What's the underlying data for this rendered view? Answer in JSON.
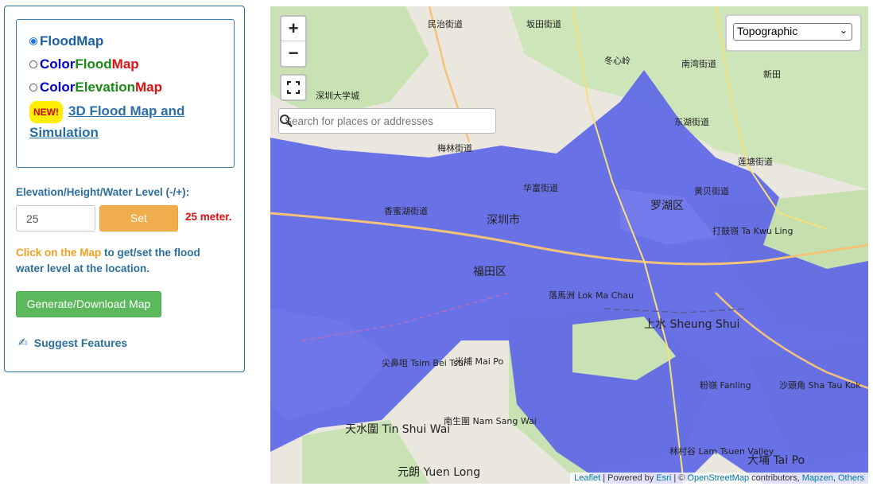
{
  "modes": {
    "floodmap": "FloodMap",
    "color_floodmap": {
      "prefix": "Color ",
      "flood": "Flood",
      "map": "Map"
    },
    "color_elevationmap": {
      "prefix": "Color ",
      "elevation": "Elevation",
      "map": "Map"
    },
    "new_badge": "NEW!",
    "flood_3d_link": "3D Flood Map and Simulation"
  },
  "level": {
    "label": "Elevation/Height/Water Level (-/+):",
    "value": "25",
    "set_button": "Set",
    "unit_display": "25 meter."
  },
  "hint": {
    "highlight": "Click on the Map",
    "rest": " to get/set the flood water level at the location."
  },
  "generate_button": "Generate/Download Map",
  "suggest_features": "Suggest Features",
  "map": {
    "zoom_in": "+",
    "zoom_out": "−",
    "search_placeholder": "Search for places or addresses",
    "layer_selected": "Topographic",
    "attribution": {
      "leaflet": "Leaflet",
      "powered": " | Powered by ",
      "esri": "Esri",
      "sep": " | © ",
      "osm": "OpenStreetMap",
      "contrib": " contributors, ",
      "mapzen": "Mapzen",
      "comma": ", ",
      "others": "Others"
    },
    "labels": [
      {
        "text": "民治街道"
      },
      {
        "text": "坂田街道"
      },
      {
        "text": "冬心岭"
      },
      {
        "text": "南湾街道"
      },
      {
        "text": "新田"
      },
      {
        "text": "深圳大学城"
      },
      {
        "text": "东湖街道"
      },
      {
        "text": "梅林街道"
      },
      {
        "text": "莲塘街道"
      },
      {
        "text": "华富街道"
      },
      {
        "text": "黄贝街道"
      },
      {
        "text": "香蜜湖街道"
      },
      {
        "text": "深圳市"
      },
      {
        "text": "罗湖区"
      },
      {
        "text": "打鼓嶺 Ta Kwu Ling"
      },
      {
        "text": "福田区"
      },
      {
        "text": "落馬洲 Lok Ma Chau"
      },
      {
        "text": "上水 Sheung Shui"
      },
      {
        "text": "尖鼻咀 Tsim Bei Tsui"
      },
      {
        "text": "米埔 Mai Po"
      },
      {
        "text": "粉嶺 Fanling"
      },
      {
        "text": "天水圍 Tin Shui Wai"
      },
      {
        "text": "南生圍 Nam Sang Wai"
      },
      {
        "text": "林村谷 Lam Tsuen Valley"
      },
      {
        "text": "大埔 Tai Po"
      },
      {
        "text": "元朗 Yuen Long"
      },
      {
        "text": "沙頭角 Sha Tau Kok"
      }
    ]
  }
}
